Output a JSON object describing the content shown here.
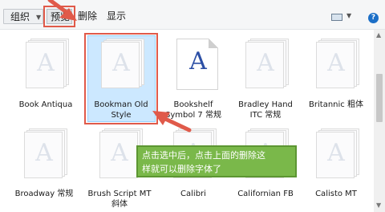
{
  "toolbar": {
    "organize_label": "组织",
    "preview_label": "预览",
    "delete_label": "删除",
    "show_label": "显示"
  },
  "fonts": [
    {
      "name": "Book Antiqua"
    },
    {
      "name": "Bookman Old Style",
      "selected": true
    },
    {
      "name": "Bookshelf Symbol 7 常规"
    },
    {
      "name": "Bradley Hand ITC 常规"
    },
    {
      "name": "Britannic 粗体"
    },
    {
      "name": "Broadway 常规"
    },
    {
      "name": "Brush Script MT 斜体"
    },
    {
      "name": "Calibri"
    },
    {
      "name": "Californian FB"
    },
    {
      "name": "Calisto MT"
    }
  ],
  "labels": {
    "book_antiqua": "Book Antiqua",
    "bookman_line1": "Bookman Old",
    "bookman_line2": "Style",
    "bookshelf_line1": "Bookshelf",
    "bookshelf_line2": "Symbol 7 常规",
    "bradley_line1": "Bradley Hand",
    "bradley_line2": "ITC 常规",
    "britannic": "Britannic 粗体",
    "broadway": "Broadway 常规",
    "brush_line1": "Brush Script MT",
    "brush_line2": "斜体",
    "calibri": "Calibri",
    "californian": "Californian FB",
    "calisto": "Calisto MT"
  },
  "glyph_letter": "A",
  "annotation": {
    "line1": "点击选中后，点击上面的删除这",
    "line2": "样就可以删除字体了"
  },
  "colors": {
    "highlight_red": "#e05a4a",
    "selection_blue": "#cce8ff",
    "callout_green": "#7ab84a",
    "glyph_blue": "#2c4fa5"
  },
  "icons": [
    "view-options-icon",
    "dropdown-caret-icon",
    "help-icon"
  ]
}
